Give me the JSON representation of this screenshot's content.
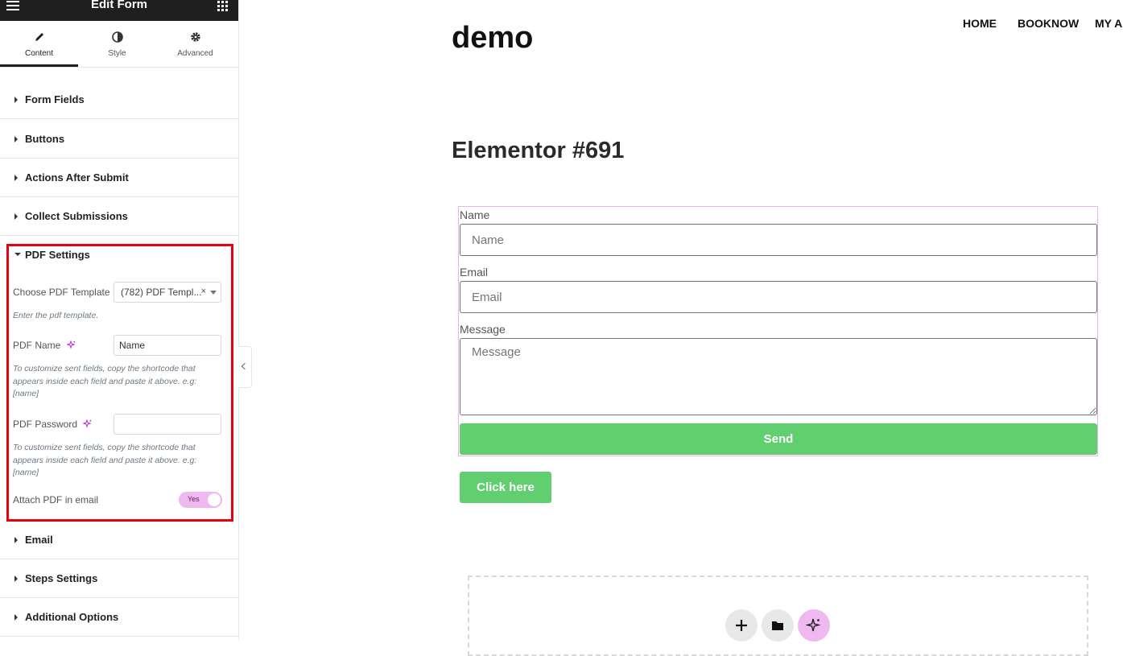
{
  "panel": {
    "title": "Edit Form",
    "tabs": [
      {
        "label": "Content",
        "icon": "pencil-icon",
        "active": true
      },
      {
        "label": "Style",
        "icon": "half-circle-icon",
        "active": false
      },
      {
        "label": "Advanced",
        "icon": "gear-icon",
        "active": false
      }
    ],
    "sections_top": [
      "Form Fields",
      "Buttons",
      "Actions After Submit",
      "Collect Submissions"
    ],
    "pdf": {
      "title": "PDF Settings",
      "template_label": "Choose PDF Template",
      "template_value": "(782) PDF Templ...",
      "template_clear": "×",
      "template_hint": "Enter the pdf template.",
      "name_label": "PDF Name",
      "name_value": "Name",
      "name_hint": "To customize sent fields, copy the shortcode that appears inside each field and paste it above. e.g: [name]",
      "password_label": "PDF Password",
      "password_value": "",
      "password_hint": "To customize sent fields, copy the shortcode that appears inside each field and paste it above. e.g: [name]",
      "attach_label": "Attach PDF in email",
      "attach_toggle": "Yes"
    },
    "sections_bottom": [
      "Email",
      "Steps Settings",
      "Additional Options"
    ]
  },
  "site": {
    "logo": "demo",
    "nav": [
      "HOME",
      "BOOKNOW",
      "MY A"
    ]
  },
  "page": {
    "heading": "Elementor #691",
    "form": {
      "name_label": "Name",
      "name_placeholder": "Name",
      "email_label": "Email",
      "email_placeholder": "Email",
      "message_label": "Message",
      "message_placeholder": "Message",
      "send_label": "Send"
    },
    "click_label": "Click here"
  },
  "colors": {
    "accent_green": "#61ce70",
    "highlight_red": "#e8000d",
    "ai_pink": "#f0b8f0",
    "dark": "#1f1f1f"
  }
}
